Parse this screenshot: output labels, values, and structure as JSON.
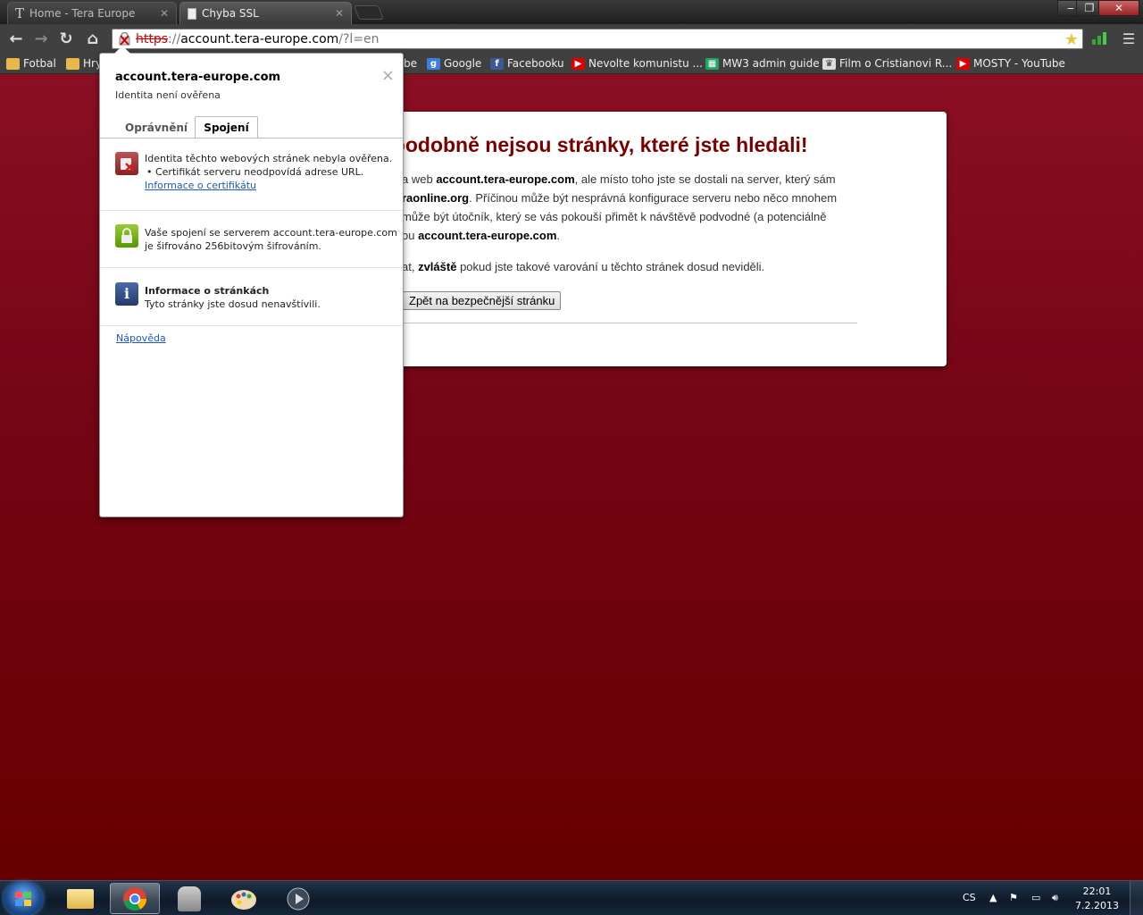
{
  "browser": {
    "tabs": [
      {
        "title": "Home - Tera Europe",
        "icon": "tera-icon"
      },
      {
        "title": "Chyba SSL",
        "icon": "page-icon"
      }
    ],
    "url": {
      "scheme": "https",
      "separator": "://",
      "host": "account.tera-europe.com",
      "path": "/?l=en"
    }
  },
  "bookmarks": [
    {
      "label": "Fotbal",
      "icon": "folder-icon"
    },
    {
      "label": "Hry",
      "icon": "folder-icon"
    },
    {
      "label": "be",
      "icon": "youtube-icon"
    },
    {
      "label": "Google",
      "icon": "google-icon"
    },
    {
      "label": "Facebooku",
      "icon": "facebook-icon"
    },
    {
      "label": "Nevolte komunistu ...",
      "icon": "youtube-icon"
    },
    {
      "label": "MW3 admin guide",
      "icon": "sheets-icon"
    },
    {
      "label": "Film o Cristianovi R...",
      "icon": "realmadrid-icon"
    },
    {
      "label": "MOSTY - YouTube",
      "icon": "youtube-icon"
    }
  ],
  "error_page": {
    "title": "epodobně nejsou stránky, které jste hledali!",
    "line1_a": "a web ",
    "line1_b": "account.tera-europe.com",
    "line1_c": ", ale místo toho jste se dostali na server, který sám",
    "line2_a": "raonline.org",
    "line2_b": ". Příčinou může být nesprávná konfigurace serveru nebo něco mnohem",
    "line3": " může být útočník, který se vás pokouší přimět k návštěvě podvodné (a potenciálně",
    "line4_a": "ou ",
    "line4_b": "account.tera-europe.com",
    "line4_c": ".",
    "line5_a": "at, ",
    "line5_b": "zvláště",
    "line5_c": " pokud jste takové varování u těchto stránek dosud neviděli.",
    "back_button": "Zpět na bezpečnější stránku"
  },
  "site_info": {
    "host": "account.tera-europe.com",
    "subtitle": "Identita není ověřena",
    "close": "×",
    "tabs": {
      "permissions": "Oprávnění",
      "connection": "Spojení"
    },
    "identity_line1": "Identita těchto webových stránek nebyla ověřena.",
    "identity_line2": "• Certifikát serveru neodpovídá adrese URL.",
    "cert_link": "Informace o certifikátu",
    "connection_line1": "Vaše spojení se serverem account.tera-europe.com",
    "connection_line2": "je šifrováno 256bitovým šifrováním.",
    "info_heading": "Informace o stránkách",
    "info_text": "Tyto stránky jste dosud nenavštívili.",
    "help": "Nápověda"
  },
  "taskbar": {
    "apps": [
      "explorer",
      "chrome",
      "scanner",
      "paint",
      "media"
    ],
    "language": "CS",
    "time": "22:01",
    "date": "7.2.2013"
  }
}
